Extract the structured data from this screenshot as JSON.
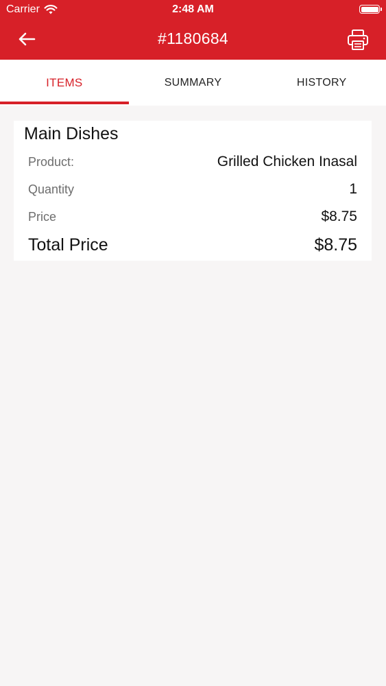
{
  "status": {
    "carrier": "Carrier",
    "time": "2:48 AM"
  },
  "nav": {
    "title": "#1180684"
  },
  "tabs": [
    {
      "label": "ITEMS",
      "active": true
    },
    {
      "label": "SUMMARY",
      "active": false
    },
    {
      "label": "HISTORY",
      "active": false
    }
  ],
  "order": {
    "section_title": "Main Dishes",
    "rows": [
      {
        "label": "Product:",
        "value": "Grilled Chicken Inasal"
      },
      {
        "label": "Quantity",
        "value": "1"
      },
      {
        "label": "Price",
        "value": "$8.75"
      }
    ],
    "total_label": "Total Price",
    "total_value": "$8.75"
  },
  "colors": {
    "brand": "#d72028",
    "background": "#f7f5f5"
  },
  "icons": {
    "back": "back-arrow-icon",
    "print": "printer-icon",
    "wifi": "wifi-icon",
    "battery": "battery-icon"
  }
}
